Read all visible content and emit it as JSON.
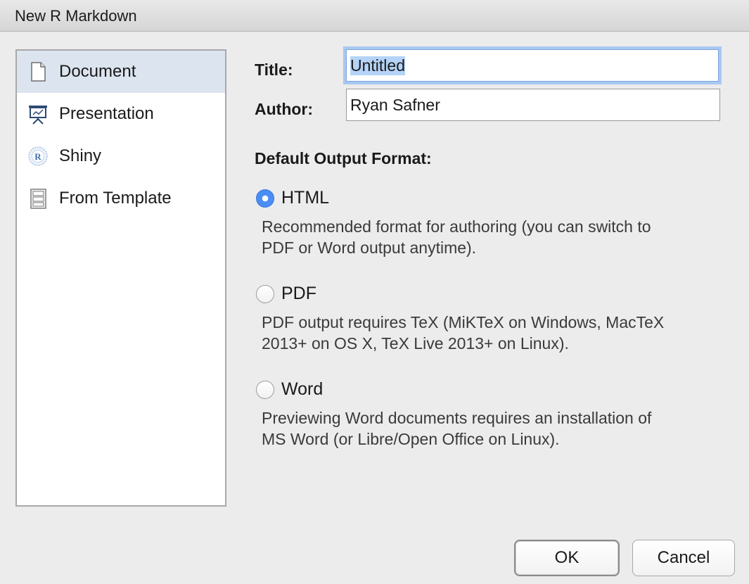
{
  "window": {
    "title": "New R Markdown"
  },
  "sidebar": {
    "items": [
      {
        "label": "Document",
        "icon": "document-icon",
        "selected": true
      },
      {
        "label": "Presentation",
        "icon": "presentation-icon",
        "selected": false
      },
      {
        "label": "Shiny",
        "icon": "shiny-icon",
        "selected": false
      },
      {
        "label": "From Template",
        "icon": "template-icon",
        "selected": false
      }
    ]
  },
  "form": {
    "title_label": "Title:",
    "title_value": "Untitled",
    "author_label": "Author:",
    "author_value": "Ryan Safner",
    "output_format_heading": "Default Output Format:"
  },
  "formats": [
    {
      "label": "HTML",
      "checked": true,
      "description_line1": "Recommended format for authoring (you can switch to",
      "description_line2": "PDF or Word output anytime)."
    },
    {
      "label": "PDF",
      "checked": false,
      "description_line1": "PDF output requires TeX (MiKTeX on Windows, MacTeX",
      "description_line2": "2013+ on OS X, TeX Live 2013+ on Linux)."
    },
    {
      "label": "Word",
      "checked": false,
      "description_line1": "Previewing Word documents requires an installation of",
      "description_line2": "MS Word (or Libre/Open Office on Linux)."
    }
  ],
  "buttons": {
    "ok_label": "OK",
    "cancel_label": "Cancel"
  },
  "colors": {
    "selection_bg": "#dce4ef",
    "radio_accent": "#4a8df5",
    "focus_ring": "#a9c8f2"
  }
}
